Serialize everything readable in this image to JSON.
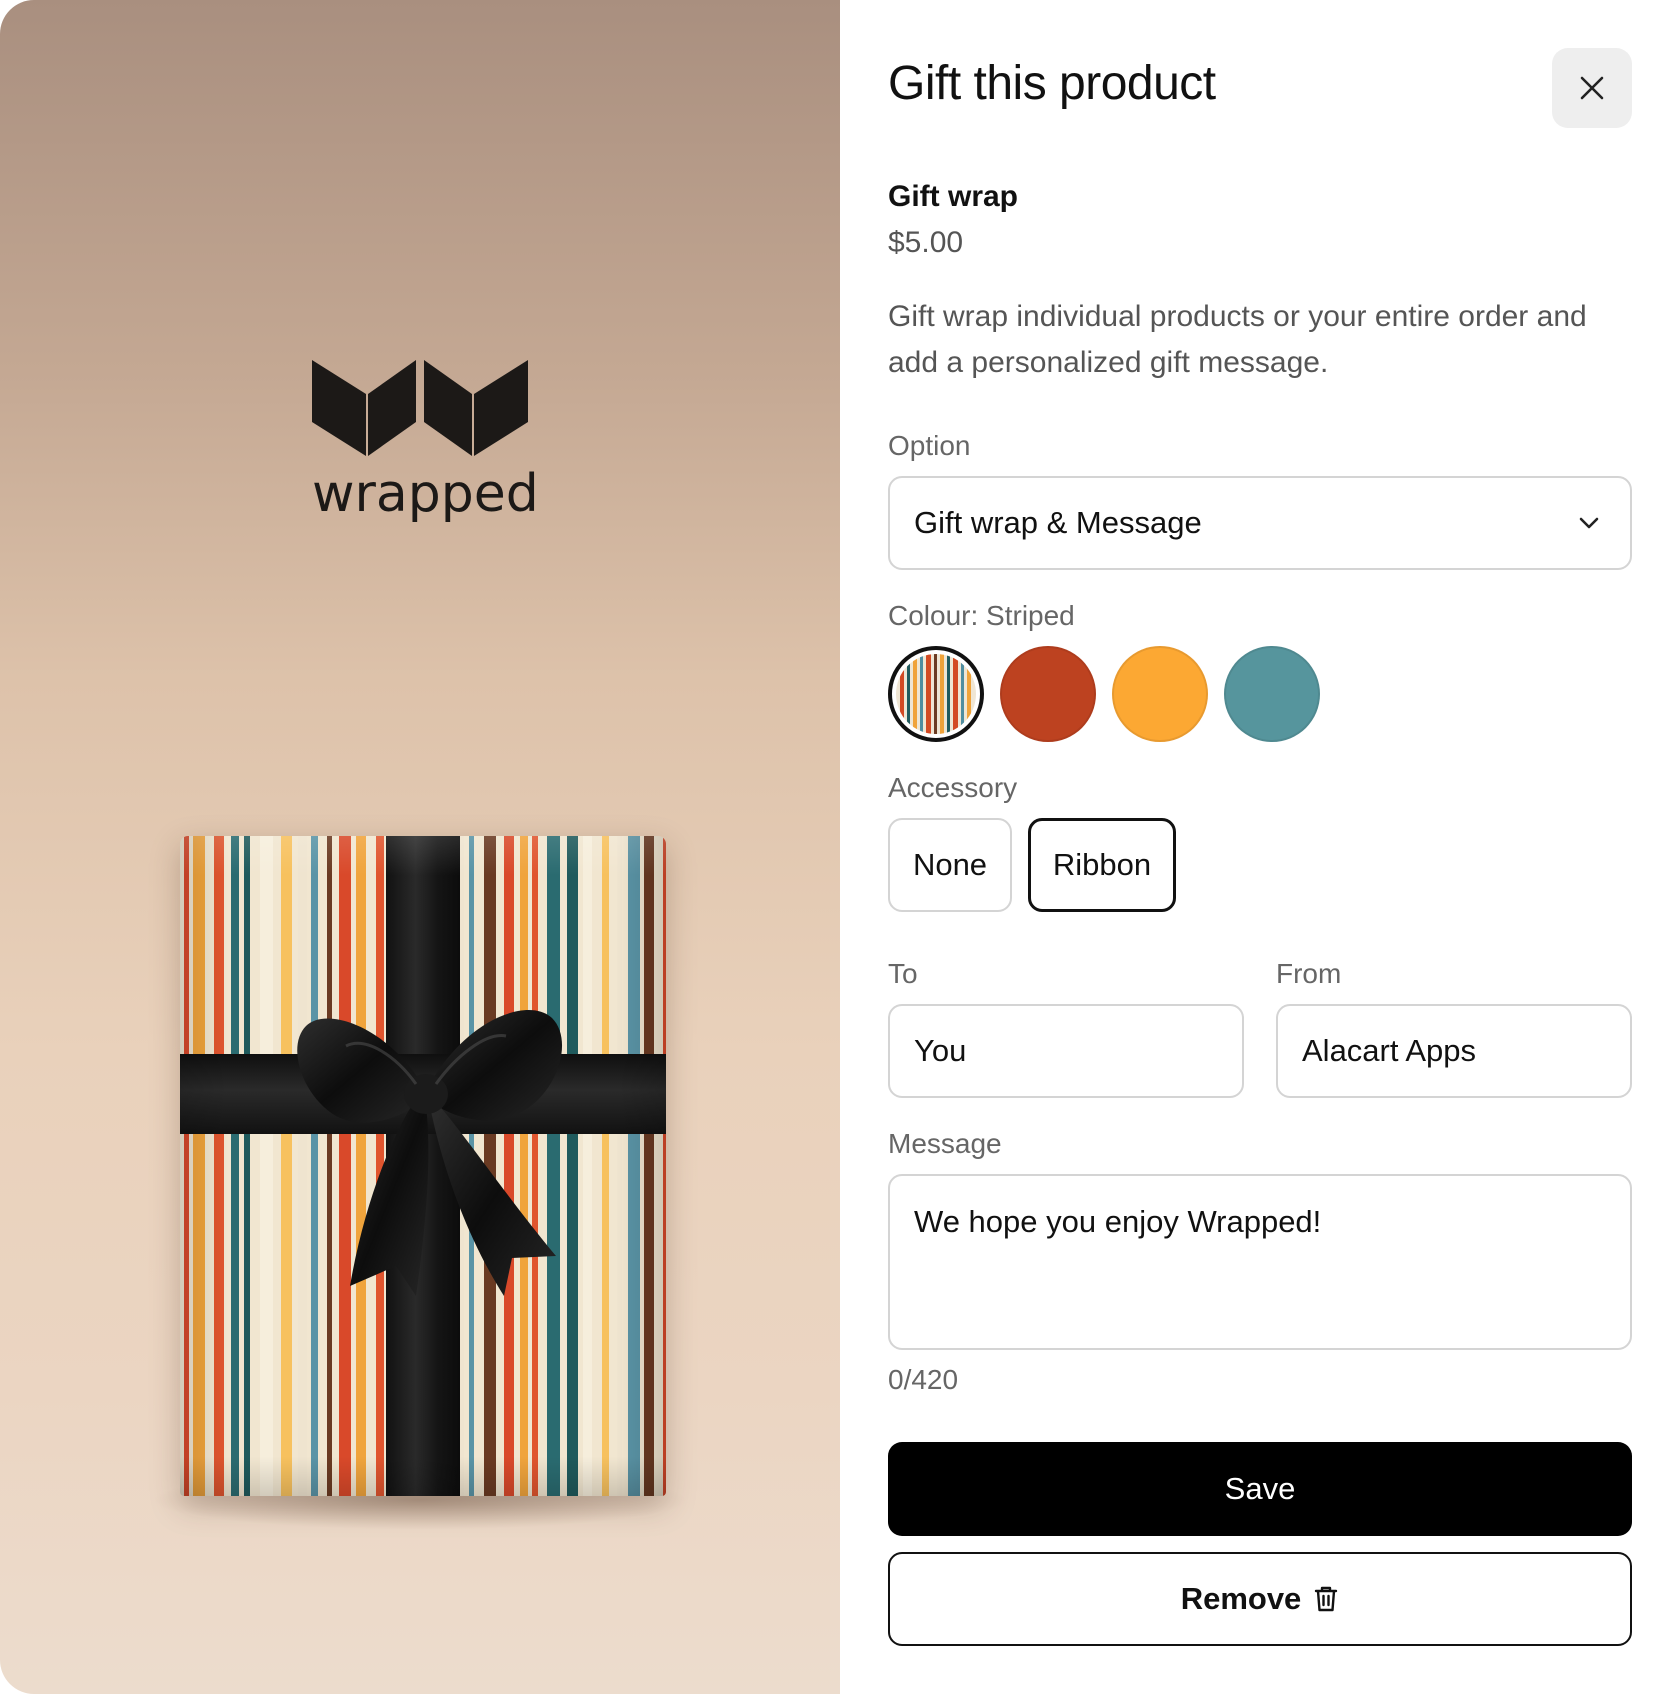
{
  "brand": {
    "wordmark": "wrapped"
  },
  "modal": {
    "title": "Gift this product",
    "close_icon": "close-icon"
  },
  "product": {
    "name": "Gift wrap",
    "price": "$5.00",
    "description": "Gift wrap individual products or your entire order and add a personalized gift message."
  },
  "option": {
    "label": "Option",
    "selected": "Gift wrap & Message",
    "icon": "chevron-down-icon"
  },
  "colour": {
    "label": "Colour: Striped",
    "selected": "Striped",
    "swatches": [
      {
        "name": "Striped",
        "color": "striped"
      },
      {
        "name": "Rust",
        "color": "#bd4220"
      },
      {
        "name": "Orange",
        "color": "#fca833"
      },
      {
        "name": "Teal",
        "color": "#56959d"
      }
    ]
  },
  "accessory": {
    "label": "Accessory",
    "options": [
      "None",
      "Ribbon"
    ],
    "selected": "Ribbon"
  },
  "to": {
    "label": "To",
    "value": "You"
  },
  "from": {
    "label": "From",
    "value": "Alacart Apps"
  },
  "message": {
    "label": "Message",
    "value": "We hope you enjoy Wrapped!",
    "counter": "0/420"
  },
  "actions": {
    "save_label": "Save",
    "remove_label": "Remove",
    "remove_icon": "trash-icon"
  },
  "colors": {
    "primary": "#000000",
    "border": "#d4d4d4",
    "muted_text": "#666666",
    "close_bg": "#eeeeee"
  }
}
